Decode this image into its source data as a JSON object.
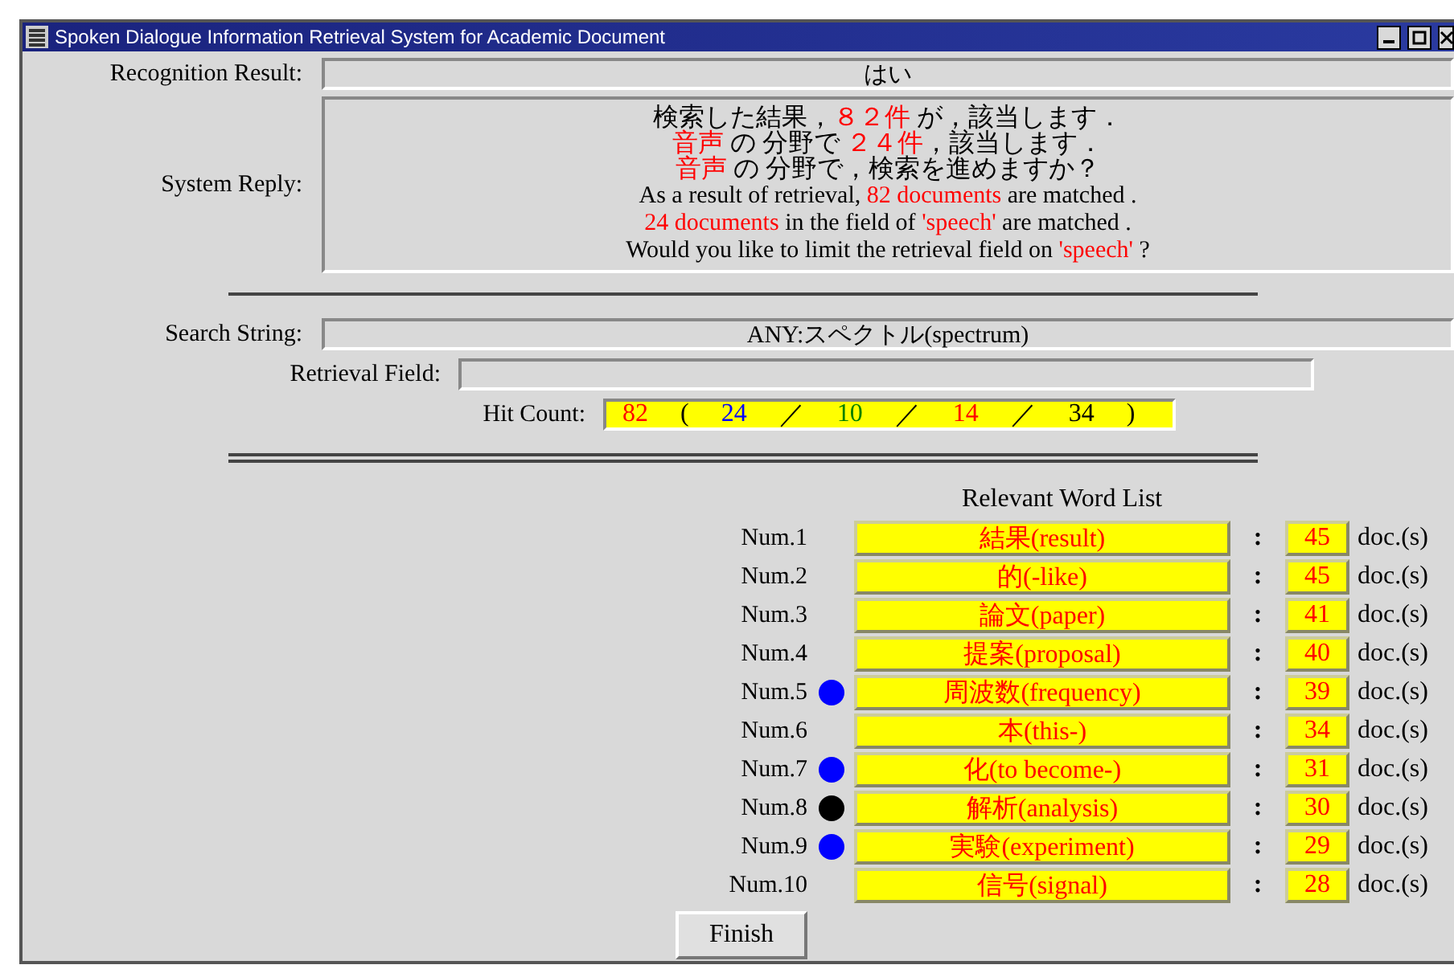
{
  "window": {
    "title": "Spoken Dialogue Information Retrieval System for Academic Document"
  },
  "recognition": {
    "label": "Recognition Result:",
    "value": "はい"
  },
  "system_reply": {
    "label": "System Reply:",
    "lines": [
      [
        {
          "text": "検索した結果，",
          "highlight": false
        },
        {
          "text": "８２件",
          "highlight": true
        },
        {
          "text": " が，該当します．",
          "highlight": false
        }
      ],
      [
        {
          "text": "音声",
          "highlight": true
        },
        {
          "text": " の 分野で ",
          "highlight": false
        },
        {
          "text": "２４件",
          "highlight": true
        },
        {
          "text": "，該当します．",
          "highlight": false
        }
      ],
      [
        {
          "text": "音声",
          "highlight": true
        },
        {
          "text": " の 分野で，検索を進めますか？",
          "highlight": false
        }
      ],
      [
        {
          "text": "As a result of retrieval, ",
          "highlight": false
        },
        {
          "text": "82 documents",
          "highlight": true
        },
        {
          "text": " are matched .",
          "highlight": false
        }
      ],
      [
        {
          "text": "24 documents",
          "highlight": true
        },
        {
          "text": " in the field of ",
          "highlight": false
        },
        {
          "text": "'speech'",
          "highlight": true
        },
        {
          "text": " are matched .",
          "highlight": false
        }
      ],
      [
        {
          "text": "Would you like to limit the retrieval field on ",
          "highlight": false
        },
        {
          "text": "'speech'",
          "highlight": true
        },
        {
          "text": " ?",
          "highlight": false
        }
      ]
    ]
  },
  "search_string": {
    "label": "Search String:",
    "value": "ANY:スペクトル(spectrum)"
  },
  "retrieval_field": {
    "label": "Retrieval Field:"
  },
  "hit_count": {
    "label": "Hit Count:",
    "parts": [
      {
        "text": "82",
        "kind": "total"
      },
      {
        "text": "(",
        "kind": "bracket"
      },
      {
        "text": "24",
        "kind": "field"
      },
      {
        "text": "／",
        "kind": "separator"
      },
      {
        "text": "10",
        "kind": "field"
      },
      {
        "text": "／",
        "kind": "separator"
      },
      {
        "text": "14",
        "kind": "field"
      },
      {
        "text": "／",
        "kind": "separator"
      },
      {
        "text": "34",
        "kind": "field"
      },
      {
        "text": ")",
        "kind": "bracket"
      }
    ]
  },
  "word_list": {
    "title": "Relevant Word List",
    "rows": [
      {
        "num": "Num.1",
        "word": "結果(result)",
        "sep": ":",
        "count": "45",
        "unit": "doc.(s)"
      },
      {
        "num": "Num.2",
        "word": "的(-like)",
        "sep": ":",
        "count": "45",
        "unit": "doc.(s)"
      },
      {
        "num": "Num.3",
        "word": "論文(paper)",
        "sep": ":",
        "count": "41",
        "unit": "doc.(s)"
      },
      {
        "num": "Num.4",
        "word": "提案(proposal)",
        "sep": ":",
        "count": "40",
        "unit": "doc.(s)"
      },
      {
        "num": "Num.5",
        "color": "#0000ff",
        "word": "周波数(frequency)",
        "sep": ":",
        "count": "39",
        "unit": "doc.(s)"
      },
      {
        "num": "Num.6",
        "word": "本(this-)",
        "sep": ":",
        "count": "34",
        "unit": "doc.(s)"
      },
      {
        "num": "Num.7",
        "color": "#0000ff",
        "word": "化(to become-)",
        "sep": ":",
        "count": "31",
        "unit": "doc.(s)"
      },
      {
        "num": "Num.8",
        "color": "#000000",
        "word": "解析(analysis)",
        "sep": ":",
        "count": "30",
        "unit": "doc.(s)"
      },
      {
        "num": "Num.9",
        "color": "#0000ff",
        "word": "実験(experiment)",
        "sep": ":",
        "count": "29",
        "unit": "doc.(s)"
      },
      {
        "num": "Num.10",
        "word": "信号(signal)",
        "sep": ":",
        "count": "28",
        "unit": "doc.(s)"
      }
    ]
  },
  "finish_button": "Finish"
}
